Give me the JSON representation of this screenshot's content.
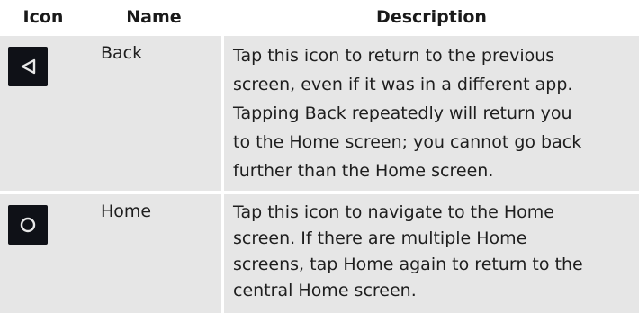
{
  "header": {
    "icon": "Icon",
    "name": "Name",
    "description": "Description"
  },
  "rows": [
    {
      "icon": "back-triangle-icon",
      "name": "Back",
      "description_lines": [
        "Tap this icon to return to the previous",
        "screen, even if it was in a different app.",
        "Tapping Back repeatedly will return you",
        "to the Home screen; you cannot go back",
        "further than the Home screen."
      ]
    },
    {
      "icon": "home-circle-icon",
      "name": "Home",
      "description_lines": [
        "Tap this icon to navigate to the Home",
        "screen. If there are multiple Home",
        "screens, tap Home again to return to the",
        "central Home screen."
      ]
    }
  ],
  "colors": {
    "row_background": "#e6e6e6",
    "icon_tile": "#0f1117",
    "icon_glyph": "#e8e8e8",
    "text": "#1e1e1e"
  }
}
